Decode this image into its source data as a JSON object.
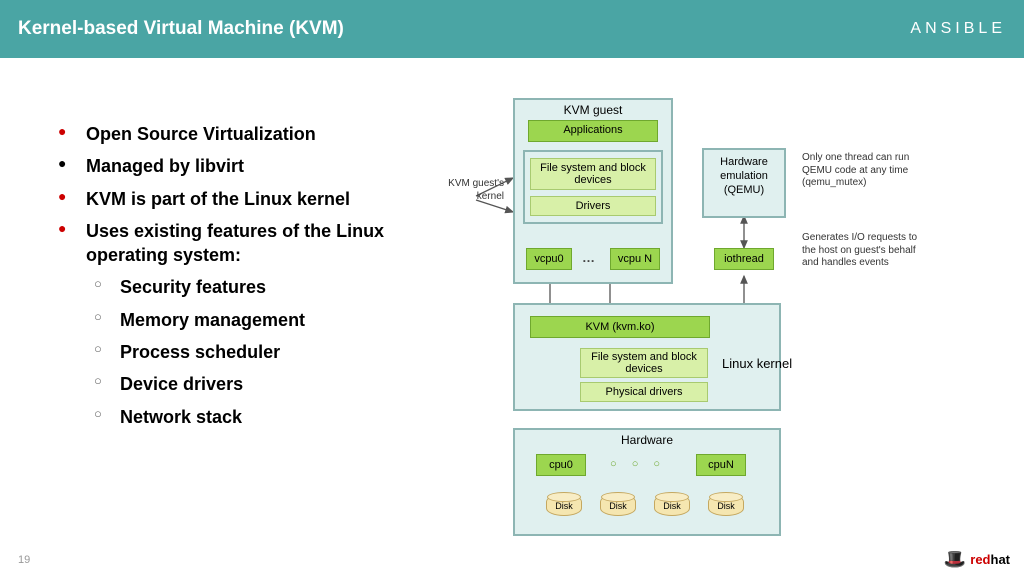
{
  "header": {
    "title": "Kernel-based Virtual Machine (KVM)",
    "brand": "ANSIBLE"
  },
  "page_number": "19",
  "redhat": {
    "red": "red",
    "hat": "hat"
  },
  "bullets": {
    "i0": "Open Source Virtualization",
    "i1": "Managed by libvirt",
    "i2": "KVM is part of the Linux kernel",
    "i3": "Uses existing features of the Linux operating system:",
    "s0": "Security features",
    "s1": "Memory management",
    "s2": "Process scheduler",
    "s3": "Device drivers",
    "s4": "Network stack"
  },
  "diagram": {
    "kvm_guest": "KVM guest",
    "applications": "Applications",
    "fs_block": "File system and block devices",
    "drivers": "Drivers",
    "vcpu0": "vcpu0",
    "vcpuN": "vcpu N",
    "ellipsis": "…",
    "hw_emulation": "Hardware emulation (QEMU)",
    "iothread": "iothread",
    "kvm_ko": "KVM (kvm.ko)",
    "fs_block2": "File system and block devices",
    "phys_drivers": "Physical drivers",
    "linux_kernel": "Linux kernel",
    "hardware": "Hardware",
    "cpu0": "cpu0",
    "cpuN": "cpuN",
    "cpu_dots": "○  ○  ○",
    "disk": "Disk",
    "annot_kernel": "KVM guest's kernel",
    "annot_qemu": "Only one thread can run QEMU code at any time (qemu_mutex)",
    "annot_io": "Generates I/O requests to the host on guest's behalf and handles events"
  }
}
